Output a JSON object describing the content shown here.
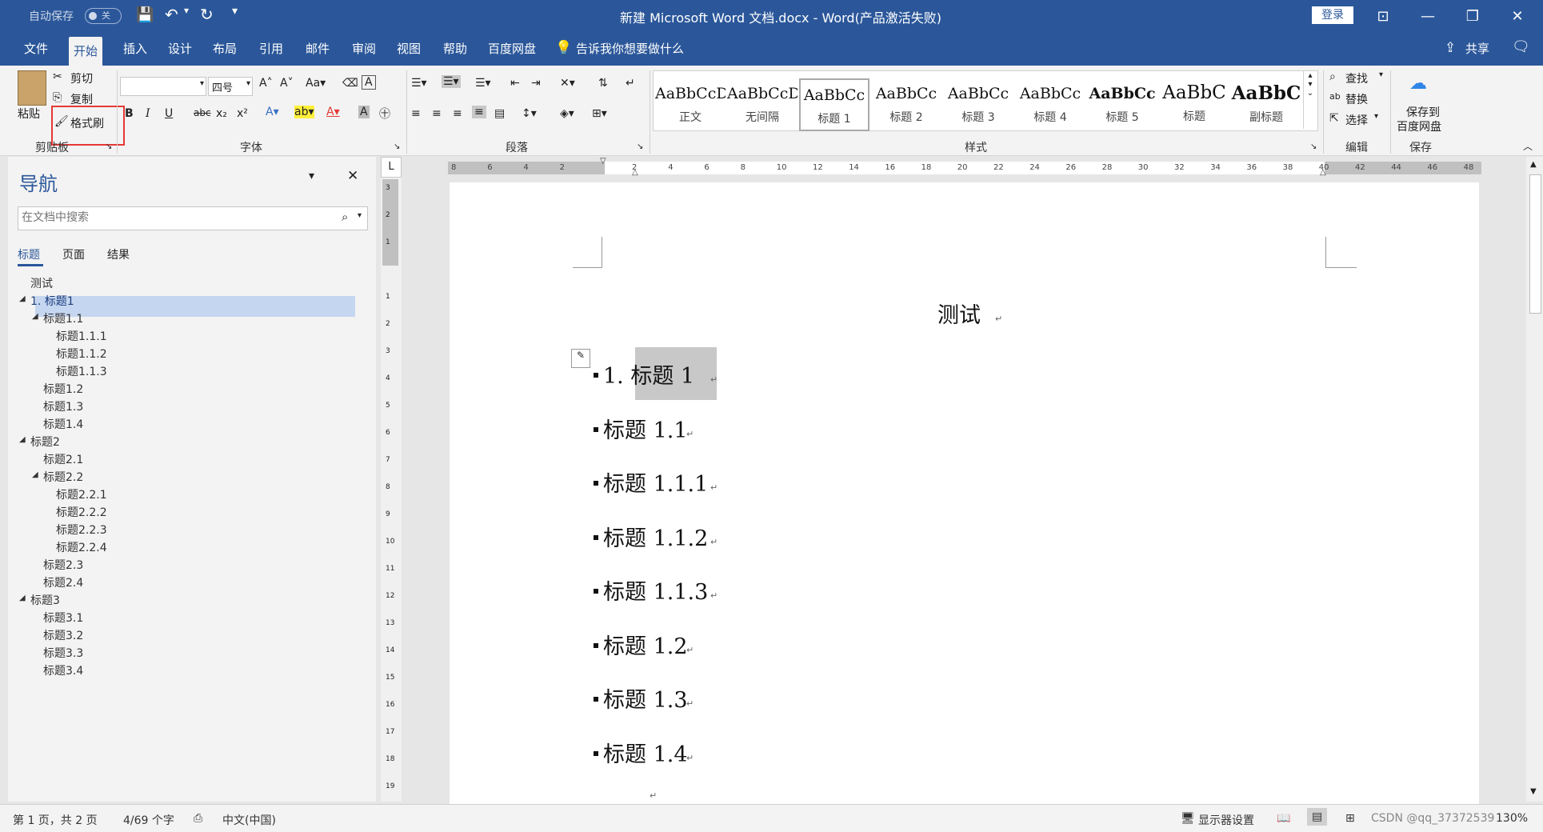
{
  "titlebar": {
    "autosave_label": "自动保存",
    "autosave_state": "关",
    "title": "新建 Microsoft Word 文档.docx - Word(产品激活失败)",
    "login_button": "登录"
  },
  "menu": {
    "items": [
      "文件",
      "开始",
      "插入",
      "设计",
      "布局",
      "引用",
      "邮件",
      "审阅",
      "视图",
      "帮助",
      "百度网盘"
    ],
    "active": "开始",
    "tell_me": "告诉我你想要做什么",
    "share": "共享"
  },
  "ribbon": {
    "clipboard": {
      "paste": "粘贴",
      "cut": "剪切",
      "copy": "复制",
      "format_painter": "格式刷",
      "label": "剪贴板"
    },
    "font": {
      "font_name": "",
      "font_size": "四号",
      "label": "字体",
      "bold": "B",
      "italic": "I",
      "underline": "U",
      "strike": "abc"
    },
    "paragraph": {
      "label": "段落"
    },
    "styles": {
      "label": "样式",
      "items": [
        {
          "sample": "AaBbCcDc",
          "name": "正文"
        },
        {
          "sample": "AaBbCcDc",
          "name": "无间隔"
        },
        {
          "sample": "AaBbCc",
          "name": "标题 1"
        },
        {
          "sample": "AaBbCc",
          "name": "标题 2"
        },
        {
          "sample": "AaBbCc",
          "name": "标题 3"
        },
        {
          "sample": "AaBbCc",
          "name": "标题 4"
        },
        {
          "sample": "AaBbCc",
          "name": "标题 5"
        },
        {
          "sample": "AaBbC",
          "name": "标题"
        },
        {
          "sample": "AaBbC",
          "name": "副标题"
        }
      ]
    },
    "editing": {
      "find": "查找",
      "replace": "替换",
      "select": "选择",
      "label": "编辑"
    },
    "save": {
      "save_to_baidu_line1": "保存到",
      "save_to_baidu_line2": "百度网盘",
      "label": "保存"
    }
  },
  "nav": {
    "title": "导航",
    "search_placeholder": "在文档中搜索",
    "tabs": [
      "标题",
      "页面",
      "结果"
    ],
    "tree": [
      "测试",
      "1. 标题1",
      "标题1.1",
      "标题1.1.1",
      "标题1.1.2",
      "标题1.1.3",
      "标题1.2",
      "标题1.3",
      "标题1.4",
      "标题2",
      "标题2.1",
      "标题2.2",
      "标题2.2.1",
      "标题2.2.2",
      "标题2.2.3",
      "标题2.2.4",
      "标题2.3",
      "标题2.4",
      "标题3",
      "标题3.1",
      "标题3.2",
      "标题3.3",
      "标题3.4"
    ]
  },
  "ruler": {
    "ticks": [
      "8",
      "6",
      "4",
      "2",
      "",
      "2",
      "4",
      "6",
      "8",
      "10",
      "12",
      "14",
      "16",
      "18",
      "20",
      "22",
      "24",
      "26",
      "28",
      "30",
      "32",
      "34",
      "36",
      "38",
      "40",
      "42",
      "44",
      "46",
      "48"
    ],
    "vticks": [
      "3",
      "2",
      "1",
      "",
      "1",
      "2",
      "3",
      "4",
      "5",
      "6",
      "7",
      "8",
      "9",
      "10",
      "11",
      "12",
      "13",
      "14",
      "15",
      "16",
      "17",
      "18",
      "19"
    ]
  },
  "document": {
    "title": "测试",
    "headings": [
      "1.  标题 1",
      "标题 1.1",
      "标题 1.1.1",
      "标题 1.1.2",
      "标题 1.1.3",
      "标题 1.2",
      "标题 1.3",
      "标题 1.4"
    ]
  },
  "status": {
    "page": "第 1 页，共 2 页",
    "words": "4/69 个字",
    "language": "中文(中国)",
    "display_settings": "显示器设置",
    "zoom": "130%",
    "watermark": "CSDN @qq_37372539"
  }
}
